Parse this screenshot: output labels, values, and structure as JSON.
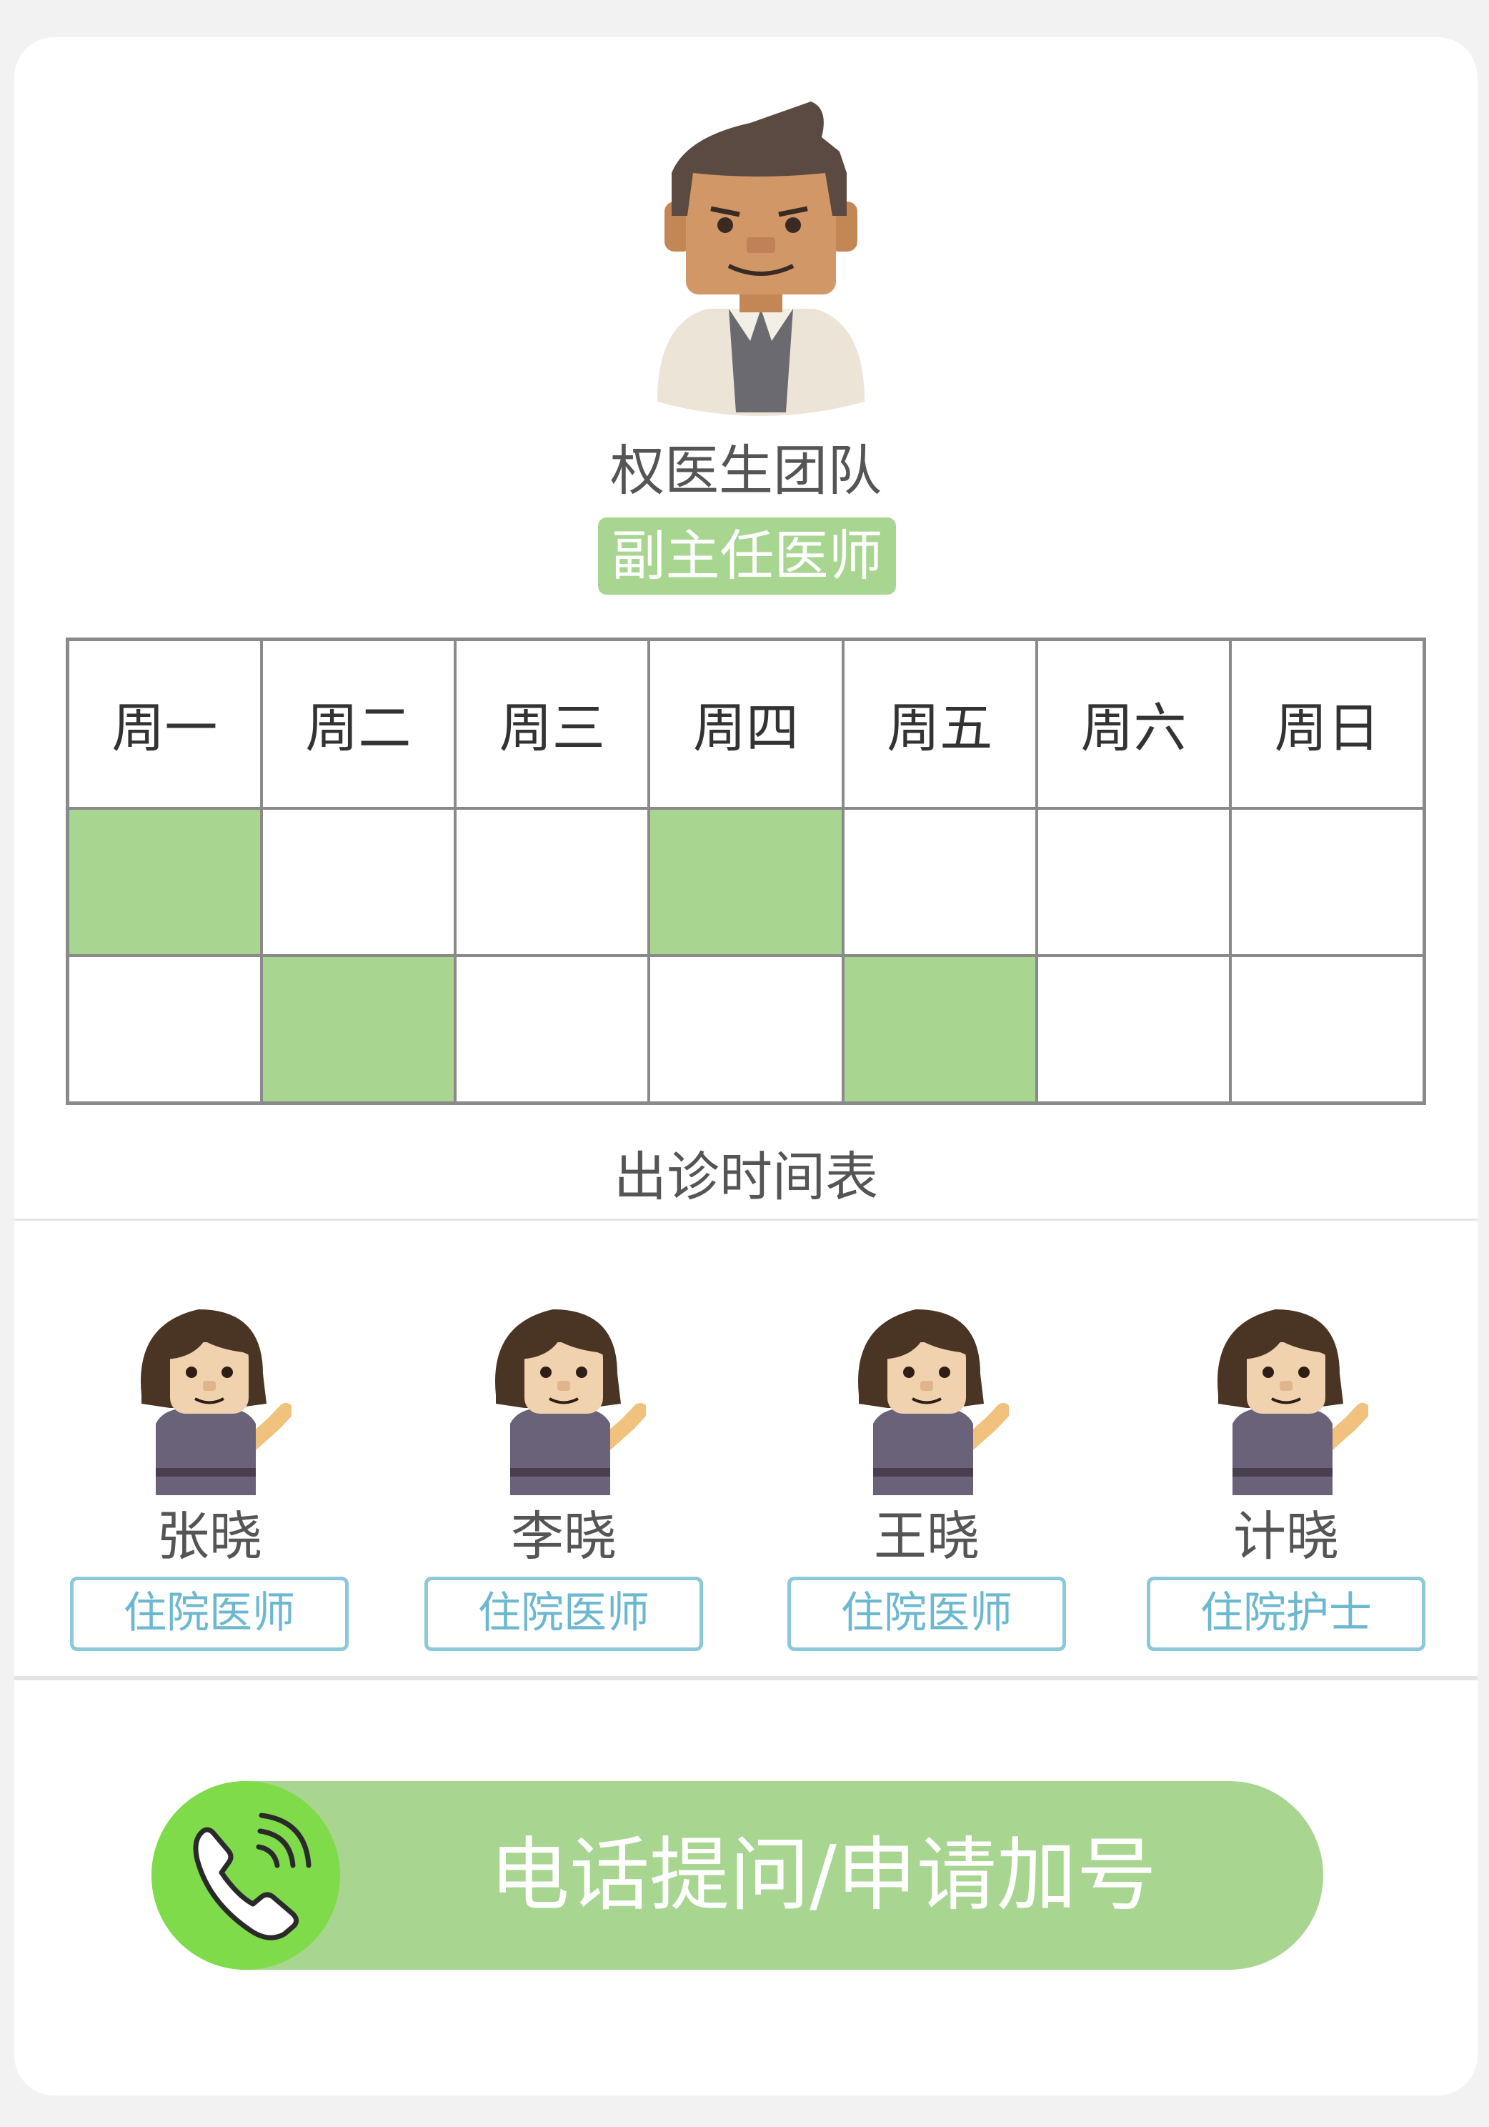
{
  "doctor": {
    "name": "权医生团队",
    "title": "副主任医师",
    "avatar_icon": "male-doctor-avatar-icon"
  },
  "schedule": {
    "days": [
      "周一",
      "周二",
      "周三",
      "周四",
      "周五",
      "周六",
      "周日"
    ],
    "rows": [
      [
        true,
        false,
        false,
        true,
        false,
        false,
        false
      ],
      [
        false,
        true,
        false,
        false,
        true,
        false,
        false
      ]
    ],
    "caption": "出诊时间表",
    "active_color": "#a8d691"
  },
  "team": [
    {
      "name": "张晓",
      "role": "住院医师"
    },
    {
      "name": "李晓",
      "role": "住院医师"
    },
    {
      "name": "王晓",
      "role": "住院医师"
    },
    {
      "name": "计晓",
      "role": "住院护士"
    }
  ],
  "call_button": {
    "label": "电话提问/申请加号",
    "icon": "phone-icon"
  },
  "colors": {
    "accent_green": "#a8d691",
    "phone_green": "#7fdb4a",
    "role_blue": "#6cb8cf"
  }
}
